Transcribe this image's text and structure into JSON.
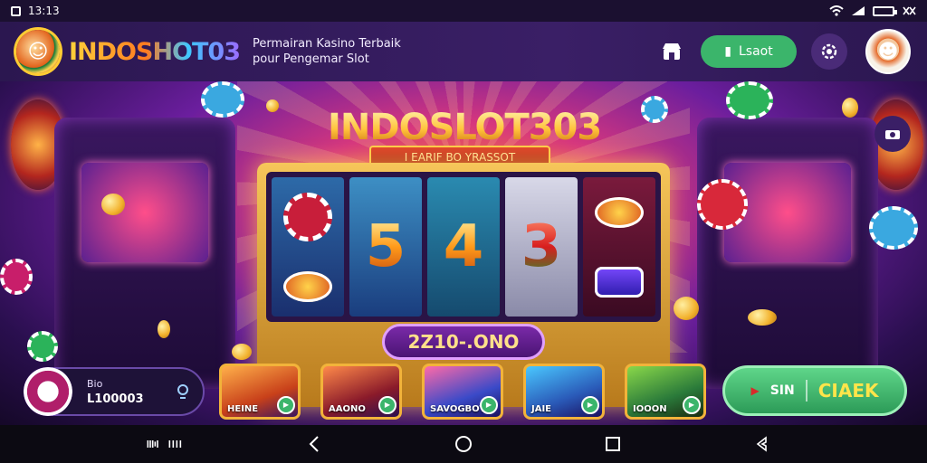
{
  "status_bar": {
    "time": "13:13"
  },
  "header": {
    "brand": "INDOSHOT03",
    "tagline": "Permairan Kasino Terbaik pour Pengemar Slot",
    "login_label": "Lsaot",
    "colors": {
      "accent_green": "#3bb56b",
      "header_bg": "#3a1f66"
    }
  },
  "hero": {
    "title": "INDOSLOT303",
    "subtitle": "I EARIF BO YRASSOT",
    "jackpot": "2Z10-.ONO",
    "reels": [
      "chip",
      "5",
      "4",
      "3",
      "badge"
    ]
  },
  "bottom": {
    "balance_label": "Bio",
    "balance_value": "L100003",
    "games": [
      {
        "name": "HEINE"
      },
      {
        "name": "AAONO"
      },
      {
        "name": "SAVOGBOT"
      },
      {
        "name": "JAIE"
      },
      {
        "name": "IOOON"
      }
    ],
    "spin_left": "SIN",
    "spin_right": "CIAEK"
  }
}
